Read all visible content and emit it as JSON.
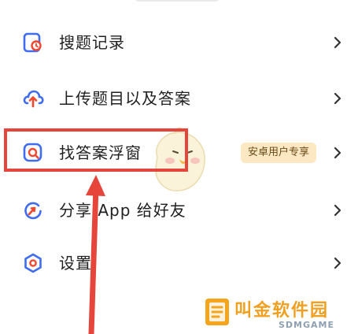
{
  "menu": {
    "items": [
      {
        "label": "搜题记录",
        "icon": "search-history-icon"
      },
      {
        "label": "上传题目以及答案",
        "icon": "cloud-upload-icon"
      },
      {
        "label": "找答案浮窗",
        "icon": "floating-search-icon",
        "badge": "安卓用户专享"
      },
      {
        "label": "分享 App 给好友",
        "icon": "share-icon"
      },
      {
        "label": "设置",
        "icon": "settings-gear-icon"
      }
    ]
  },
  "annotation": {
    "highlight_color": "#e5453a"
  },
  "colors": {
    "icon_blue": "#3f6cf0",
    "icon_red": "#f0462e",
    "badge_bg": "#fde8c4",
    "badge_text": "#6b4a16"
  },
  "watermark": {
    "text": "叫金软件园",
    "subtext": "SDMGAME"
  }
}
